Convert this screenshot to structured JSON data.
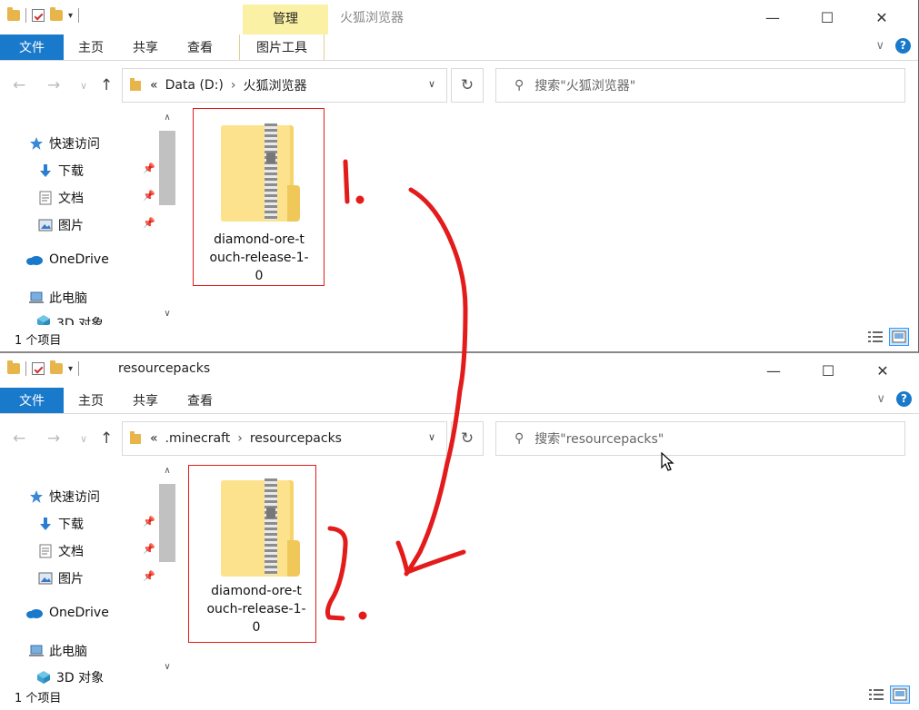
{
  "window1": {
    "title": "火狐浏览器",
    "manage_tab": "管理",
    "picture_tools_tab": "图片工具",
    "ribbon": [
      "文件",
      "主页",
      "共享",
      "查看"
    ],
    "breadcrumb": [
      "Data (D:)",
      "火狐浏览器"
    ],
    "search_placeholder": "搜索\"火狐浏览器\"",
    "nav": {
      "quick": "快速访问",
      "downloads": "下载",
      "documents": "文档",
      "pictures": "图片",
      "onedrive": "OneDrive",
      "thispc": "此电脑",
      "objects3d": "3D 对象"
    },
    "file_name_lines": [
      "diamond-ore-t",
      "ouch-release-1-",
      "0"
    ],
    "status": "1 个项目"
  },
  "window2": {
    "title": "resourcepacks",
    "ribbon": [
      "文件",
      "主页",
      "共享",
      "查看"
    ],
    "breadcrumb": [
      ".minecraft",
      "resourcepacks"
    ],
    "search_placeholder": "搜索\"resourcepacks\"",
    "nav": {
      "quick": "快速访问",
      "downloads": "下载",
      "documents": "文档",
      "pictures": "图片",
      "onedrive": "OneDrive",
      "thispc": "此电脑",
      "objects3d": "3D 对象"
    },
    "file_name_lines": [
      "diamond-ore-t",
      "ouch-release-1-",
      "0"
    ],
    "status": "1 个项目"
  },
  "icons": [
    "folder-icon",
    "properties-icon",
    "back-icon",
    "forward-icon",
    "up-icon",
    "refresh-icon",
    "search-icon",
    "star-icon",
    "download-icon",
    "document-icon",
    "picture-icon",
    "cloud-icon",
    "computer-icon",
    "cube-icon",
    "pin-icon",
    "zip-folder-icon",
    "details-view-icon",
    "large-icons-view-icon",
    "help-icon",
    "minimize-icon",
    "maximize-icon",
    "close-icon",
    "cursor-icon"
  ],
  "colors": {
    "accent": "#1979ca",
    "manage_tab": "#fbf1a4",
    "annotation": "#e31b1b"
  }
}
